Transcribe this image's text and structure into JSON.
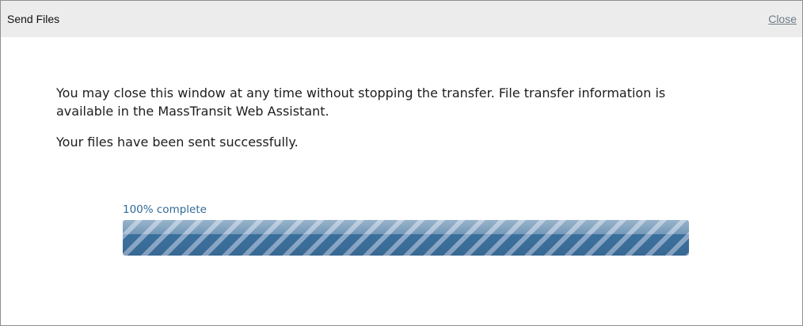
{
  "window": {
    "title": "Send Files",
    "close_label": "Close"
  },
  "content": {
    "message": "You may close this window at any time without stopping the transfer. File transfer information is available in the MassTransit Web Assistant.",
    "status": "Your files have been sent successfully."
  },
  "progress": {
    "label": "100% complete",
    "value_percent": 100
  },
  "colors": {
    "title_bar_bg": "#ececec",
    "progress_blue": "#3b6f9b",
    "progress_label_blue": "#2f6a9a",
    "close_link": "#6f7b86"
  }
}
